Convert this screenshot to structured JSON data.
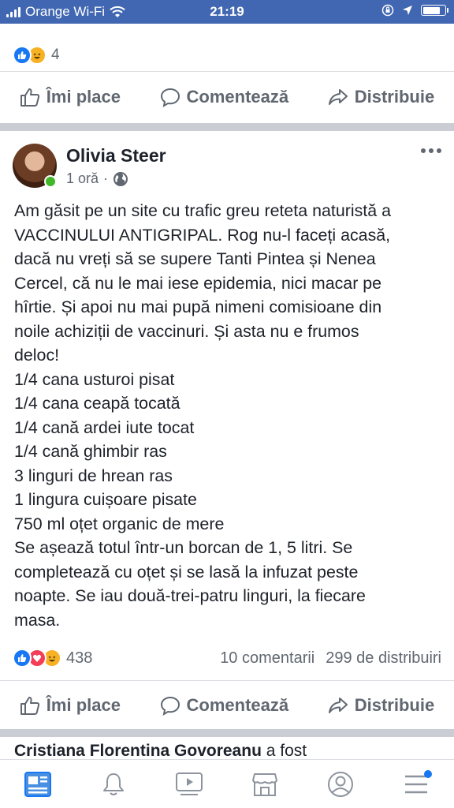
{
  "status_bar": {
    "carrier": "Orange Wi-Fi",
    "time": "21:19"
  },
  "previous_post": {
    "reaction_count": "4"
  },
  "actions": {
    "like": "Îmi place",
    "comment": "Comentează",
    "share": "Distribuie"
  },
  "post": {
    "author": "Olivia Steer",
    "time": "1 oră",
    "separator": "·",
    "body_lines": [
      "Am găsit pe un site cu trafic greu reteta naturistă a",
      "VACCINULUI ANTIGRIPAL. Rog nu-l faceți acasă,",
      "dacă nu vreți să se supere Tanti Pintea și Nenea",
      "Cercel, că nu le mai iese epidemia, nici macar pe",
      "hîrtie. Și apoi nu mai pupă nimeni comisioane din",
      "noile achiziții de vaccinuri. Și asta nu e frumos",
      "deloc!",
      "1/4 cana usturoi pisat",
      "1/4 cana ceapă tocată",
      "1/4 cană ardei iute tocat",
      "1/4 cană ghimbir ras",
      "3 linguri de hrean ras",
      "1 lingura cuișoare pisate",
      "750 ml oțet organic de mere",
      "Se așează totul într-un borcan de 1, 5 litri. Se",
      "completează cu oțet și se lasă la infuzat peste",
      "noapte.  Se iau două-trei-patru linguri, la fiecare",
      "masa."
    ],
    "reaction_count": "438",
    "comments": "10 comentarii",
    "shares": "299 de distribuiri"
  },
  "next_post": {
    "author": "Cristiana Florentina Govoreanu",
    "text": "a fost"
  },
  "tabs": [
    "news-feed",
    "notifications",
    "watch",
    "marketplace",
    "profile",
    "menu"
  ],
  "colors": {
    "brand": "#4267b2",
    "like": "#1877f2",
    "love": "#f33e58",
    "haha": "#f7b125",
    "online": "#42b72a"
  }
}
